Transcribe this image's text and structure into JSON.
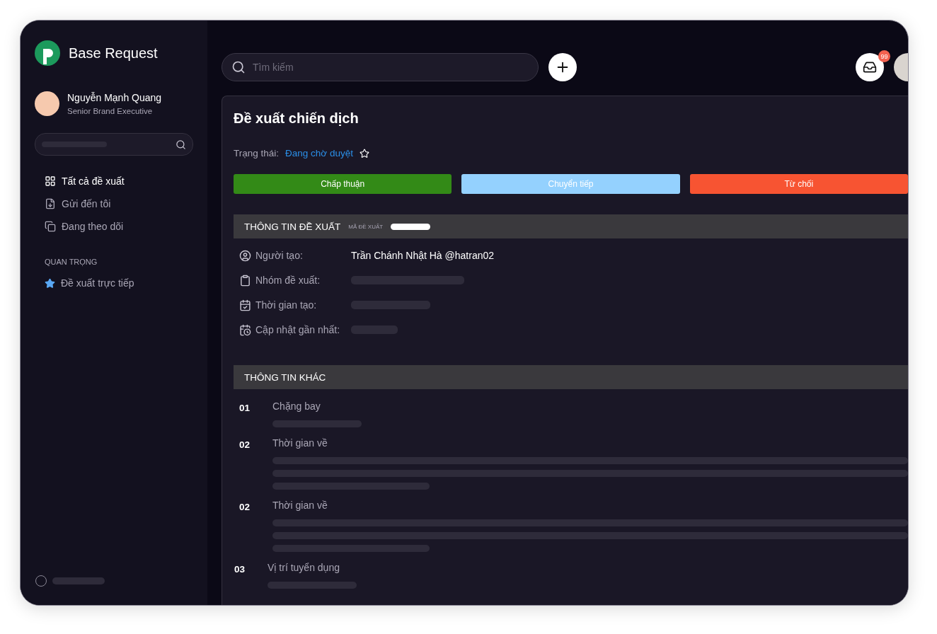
{
  "app": {
    "name": "Base Request"
  },
  "user": {
    "name": "Nguyễn Mạnh Quang",
    "role": "Senior Brand Executive"
  },
  "nav": [
    {
      "label": "Tất cả đề xuất",
      "selected": true
    },
    {
      "label": "Gửi đến tôi",
      "selected": false
    },
    {
      "label": "Đang theo dõi",
      "selected": false
    }
  ],
  "important": {
    "heading": "QUAN TRỌNG",
    "items": [
      {
        "label": "Đề xuất trực tiếp",
        "starred": true
      }
    ]
  },
  "topbar": {
    "search": {
      "placeholder": "Tìm kiếm"
    },
    "inbox_badge": "99"
  },
  "request": {
    "title": "Đề xuất chiến dịch",
    "status_label": "Trạng thái:",
    "status": "Đang chờ duyệt",
    "starred": false,
    "actions": [
      {
        "label": "Chấp thuận",
        "kind": "approve"
      },
      {
        "label": "Chuyển tiếp",
        "kind": "forward"
      },
      {
        "label": "Từ chối",
        "kind": "reject"
      }
    ],
    "info": {
      "heading": "THÔNG TIN ĐỀ XUẤT",
      "code_label": "MÃ ĐỀ XUẤT",
      "fields": [
        {
          "label": "Người tạo:",
          "value": "Trần Chánh Nhật Hà @hatran02"
        },
        {
          "label": "Nhóm đề xuất:"
        },
        {
          "label": "Thời gian tạo:"
        },
        {
          "label": "Cập nhật gần nhất:"
        }
      ]
    },
    "other": {
      "heading": "THÔNG TIN KHÁC",
      "items": [
        {
          "number": "01",
          "label": "Chặng bay",
          "kind": "short"
        },
        {
          "number": "02",
          "label": "Thời gian về",
          "kind": "long"
        },
        {
          "number": "02",
          "label": "Thời gian về",
          "kind": "long"
        },
        {
          "number": "03",
          "label": "Vị trí tuyển dụng",
          "kind": "short"
        }
      ]
    }
  }
}
